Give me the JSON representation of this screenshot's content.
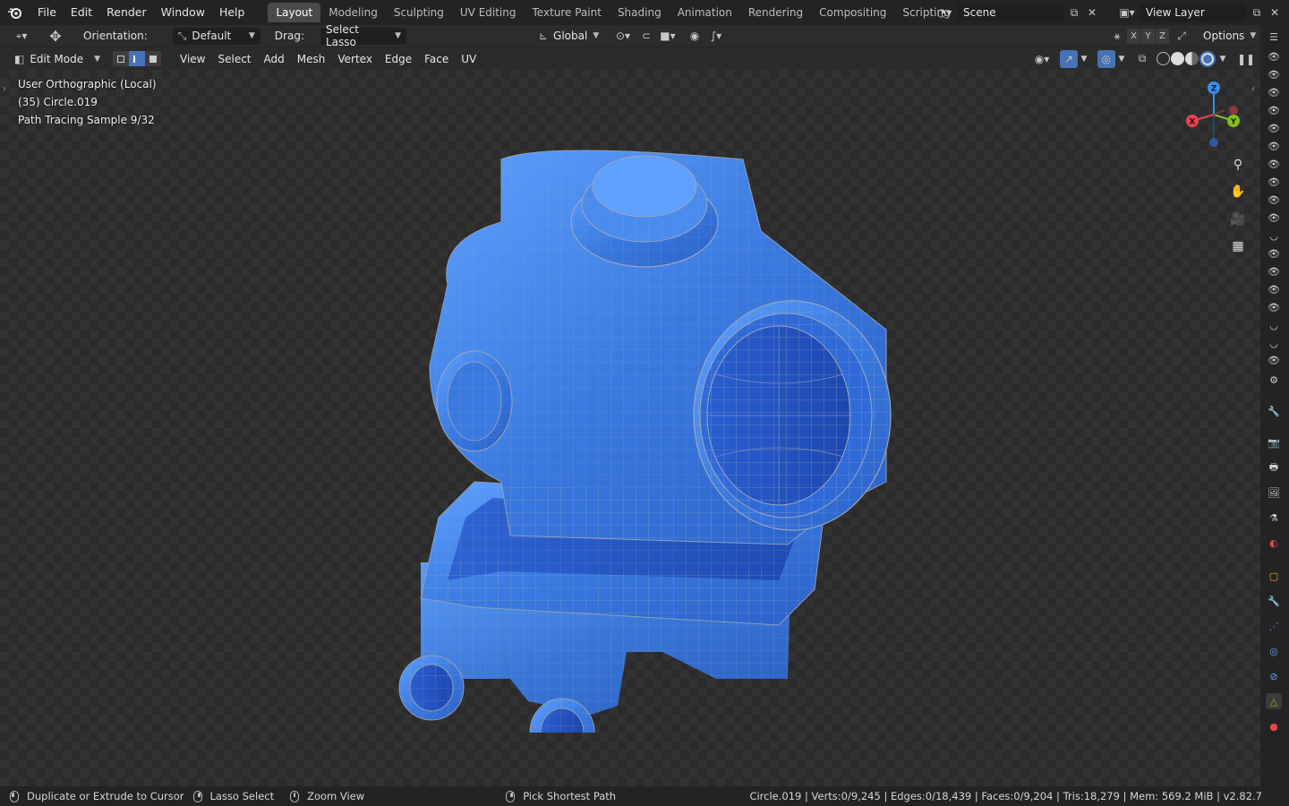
{
  "app": {
    "name": "Blender",
    "version": "v2.82.7"
  },
  "menu": [
    "File",
    "Edit",
    "Render",
    "Window",
    "Help"
  ],
  "workspaces": [
    "Layout",
    "Modeling",
    "Sculpting",
    "UV Editing",
    "Texture Paint",
    "Shading",
    "Animation",
    "Rendering",
    "Compositing",
    "Scripting"
  ],
  "active_workspace": "Layout",
  "scene": {
    "name": "Scene",
    "view_layer": "View Layer"
  },
  "tool_header": {
    "orientation_label": "Orientation:",
    "orientation_value": "Default",
    "drag_label": "Drag:",
    "drag_value": "Select Lasso",
    "transform_orientation": "Global",
    "options_label": "Options",
    "axes": [
      "X",
      "Y",
      "Z"
    ]
  },
  "editor_header": {
    "mode": "Edit Mode",
    "menus": [
      "View",
      "Select",
      "Add",
      "Mesh",
      "Vertex",
      "Edge",
      "Face",
      "UV"
    ]
  },
  "viewport_overlay": {
    "view_name": "User Orthographic (Local)",
    "object": "(35) Circle.019",
    "render_status": "Path Tracing Sample 9/32"
  },
  "gizmo": {
    "x": "X",
    "y": "Y",
    "z": "Z"
  },
  "status": {
    "left_hint": "Duplicate or Extrude to Cursor",
    "middle_hint": "Lasso Select",
    "zoom_hint": "Zoom View",
    "pick_hint": "Pick Shortest Path",
    "stats": "Circle.019 | Verts:0/9,245 | Edges:0/18,439 | Faces:0/9,204 | Tris:18,279 | Mem: 569.2 MiB | v2.82.7"
  },
  "colors": {
    "accent": "#4772b3",
    "mesh_blue": "#3a7ae0",
    "x_axis": "#e8444f",
    "y_axis": "#84bd22",
    "z_axis": "#3b8ef0"
  }
}
